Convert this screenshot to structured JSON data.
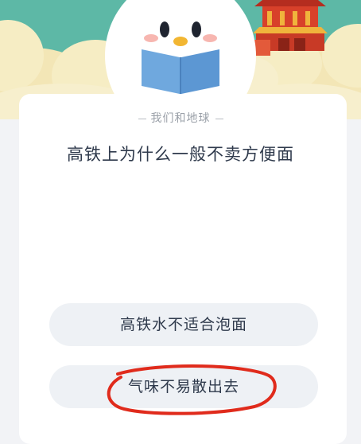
{
  "quiz": {
    "category": "我们和地球",
    "question": "高铁上为什么一般不卖方便面",
    "options": [
      {
        "label": "高铁水不适合泡面"
      },
      {
        "label": "气味不易散出去",
        "circled": true
      }
    ]
  },
  "colors": {
    "banner_sky": "#5db8a6",
    "cloud": "#f6edc4",
    "mascot": "#ffffff",
    "book": "#6fa8de",
    "temple_red": "#d8412a",
    "card_bg": "#ffffff",
    "page_bg": "#f2f3f6",
    "option_bg": "#eef1f5",
    "text": "#2f3a4c",
    "circle_ink": "#e02b1c"
  }
}
